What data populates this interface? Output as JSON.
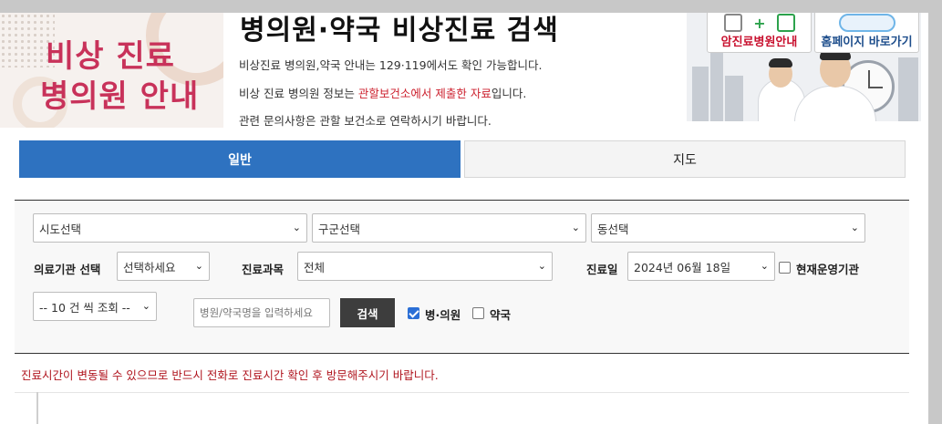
{
  "banner": {
    "line1": "비상 진료",
    "line2": "병의원 안내"
  },
  "header": {
    "title": "병의원·약국 비상진료 검색",
    "info1": "비상진료 병의원,약국 안내는 129·119에서도 확인 가능합니다.",
    "info2_pre": "비상 진료 병의원 정보는 ",
    "info2_red": "관할보건소에서 제출한 자료",
    "info2_post": "입니다.",
    "info3": "관련 문의사항은 관할 보건소로 연락하시기 바랍니다."
  },
  "promo": {
    "cancer_hospital": "암진료병원안내",
    "homepage": "홈페이지 바로가기"
  },
  "tabs": [
    {
      "label": "일반",
      "active": true
    },
    {
      "label": "지도",
      "active": false
    }
  ],
  "search": {
    "sido": "시도선택",
    "gugun": "구군선택",
    "dong": "동선택",
    "institution_label": "의료기관 선택",
    "institution_value": "선택하세요",
    "department_label": "진료과목",
    "department_value": "전체",
    "date_label": "진료일",
    "date_value": "2024년 06월 18일",
    "operating_label": "현재운영기관",
    "operating_checked": false,
    "page_size": "-- 10 건 씩 조회 --",
    "keyword_placeholder": "병원/약국명을 입력하세요",
    "search_button": "검색",
    "hospital_label": "병·의원",
    "hospital_checked": true,
    "pharmacy_label": "약국",
    "pharmacy_checked": false
  },
  "notice": "진료시간이 변동될 수 있으므로 반드시 전화로 진료시간 확인 후 방문해주시기 바랍니다.",
  "colors": {
    "tab_active": "#2e72c0",
    "banner_text": "#c8325a",
    "notice_text": "#b0151f",
    "search_button": "#3d3d3d"
  }
}
